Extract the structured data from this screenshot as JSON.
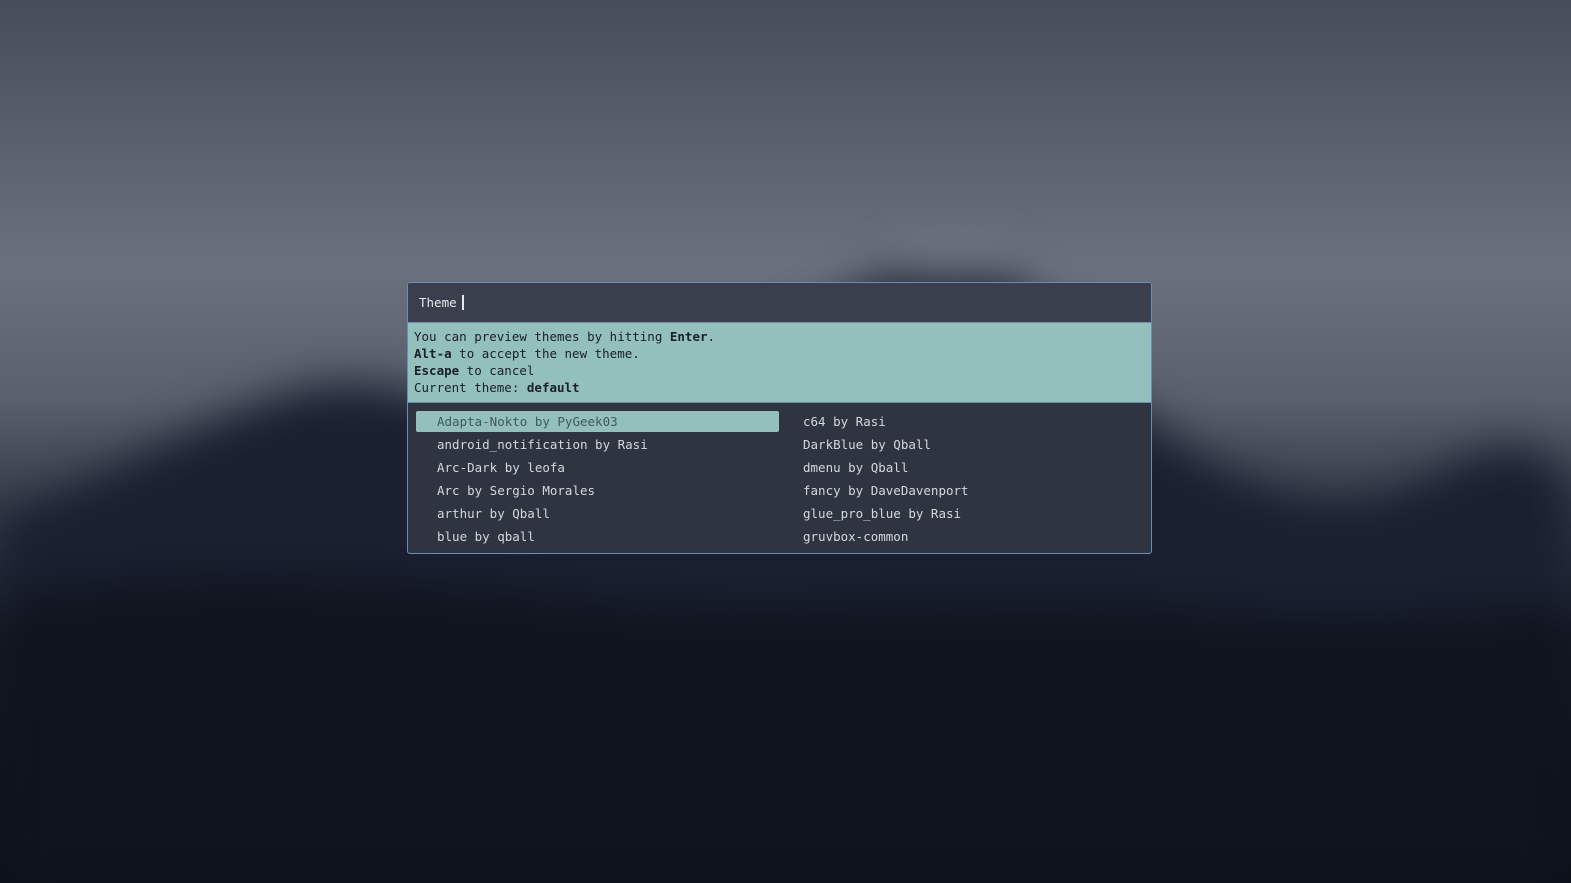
{
  "prompt": {
    "label": "Theme",
    "input_value": ""
  },
  "message": {
    "line1_pre": "You can preview themes by hitting ",
    "line1_bold": "Enter",
    "line1_post": ".",
    "line2_bold": "Alt-a",
    "line2_post": " to accept the new theme.",
    "line3_bold": "Escape",
    "line3_post": " to cancel",
    "line4_pre": "Current theme: ",
    "line4_bold": "default"
  },
  "entries": [
    {
      "label": "Adapta-Nokto by PyGeek03",
      "selected": true
    },
    {
      "label": "android_notification by Rasi",
      "selected": false
    },
    {
      "label": "Arc-Dark by leofa",
      "selected": false
    },
    {
      "label": "Arc by Sergio Morales",
      "selected": false
    },
    {
      "label": "arthur by Qball",
      "selected": false
    },
    {
      "label": "blue by qball",
      "selected": false
    },
    {
      "label": "c64 by Rasi",
      "selected": false
    },
    {
      "label": "DarkBlue by Qball",
      "selected": false
    },
    {
      "label": "dmenu by Qball",
      "selected": false
    },
    {
      "label": "fancy by DaveDavenport",
      "selected": false
    },
    {
      "label": "glue_pro_blue by Rasi",
      "selected": false
    },
    {
      "label": "gruvbox-common",
      "selected": false
    }
  ],
  "colors": {
    "accent": "#93bfbd",
    "border": "#6d8cb1",
    "window_bg": "#2f3441",
    "inputbar_bg": "#3a3f4e"
  }
}
